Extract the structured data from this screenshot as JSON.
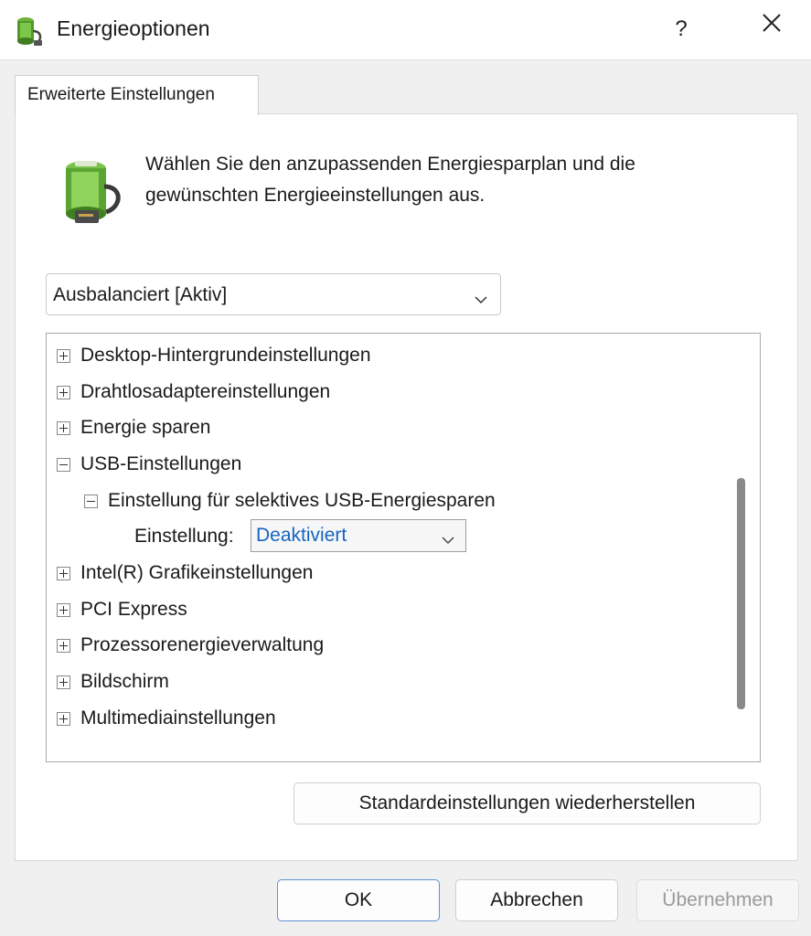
{
  "window": {
    "title": "Energieoptionen",
    "help_label": "?",
    "icon": "power-options-icon"
  },
  "tabs": [
    {
      "label": "Erweiterte Einstellungen",
      "selected": true
    }
  ],
  "header": {
    "text": "Wählen Sie den anzupassenden Energiesparplan und die gewünschten Energieeinstellungen aus.",
    "icon": "battery-plug-icon"
  },
  "plan_select": {
    "value": "Ausbalanciert [Aktiv]"
  },
  "tree": {
    "items": [
      {
        "label": "Desktop-Hintergrundeinstellungen",
        "state": "collapsed"
      },
      {
        "label": "Drahtlosadaptereinstellungen",
        "state": "collapsed"
      },
      {
        "label": "Energie sparen",
        "state": "collapsed"
      },
      {
        "label": "USB-Einstellungen",
        "state": "expanded"
      },
      {
        "label": "Einstellung für selektives USB-Energiesparen",
        "state": "expanded"
      },
      {
        "label": "Intel(R) Grafikeinstellungen",
        "state": "collapsed"
      },
      {
        "label": "PCI Express",
        "state": "collapsed"
      },
      {
        "label": "Prozessorenergieverwaltung",
        "state": "collapsed"
      },
      {
        "label": "Bildschirm",
        "state": "collapsed"
      },
      {
        "label": "Multimediainstellungen",
        "state": "collapsed"
      }
    ],
    "setting": {
      "label": "Einstellung:",
      "value": "Deaktiviert"
    }
  },
  "buttons": {
    "restore": "Standardeinstellungen wiederherstellen",
    "ok": "OK",
    "cancel": "Abbrechen",
    "apply": "Übernehmen"
  },
  "colors": {
    "accent": "#1565c0",
    "ok_border": "#5f8fd6",
    "disabled_text": "#9a9a9a"
  }
}
